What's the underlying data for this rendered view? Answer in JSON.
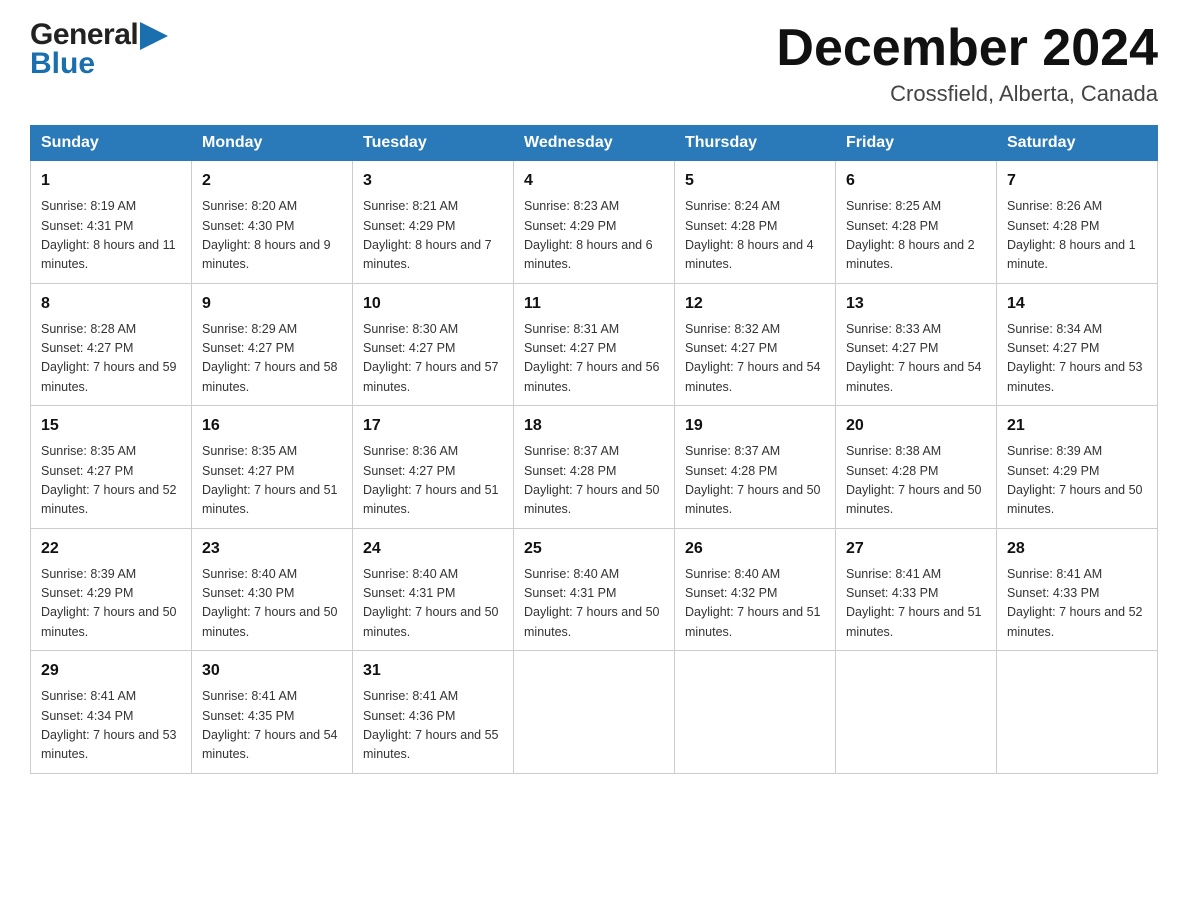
{
  "header": {
    "logo_general": "General",
    "logo_blue": "Blue",
    "month_title": "December 2024",
    "location": "Crossfield, Alberta, Canada"
  },
  "days_of_week": [
    "Sunday",
    "Monday",
    "Tuesday",
    "Wednesday",
    "Thursday",
    "Friday",
    "Saturday"
  ],
  "weeks": [
    [
      {
        "day": "1",
        "sunrise": "8:19 AM",
        "sunset": "4:31 PM",
        "daylight": "8 hours and 11 minutes."
      },
      {
        "day": "2",
        "sunrise": "8:20 AM",
        "sunset": "4:30 PM",
        "daylight": "8 hours and 9 minutes."
      },
      {
        "day": "3",
        "sunrise": "8:21 AM",
        "sunset": "4:29 PM",
        "daylight": "8 hours and 7 minutes."
      },
      {
        "day": "4",
        "sunrise": "8:23 AM",
        "sunset": "4:29 PM",
        "daylight": "8 hours and 6 minutes."
      },
      {
        "day": "5",
        "sunrise": "8:24 AM",
        "sunset": "4:28 PM",
        "daylight": "8 hours and 4 minutes."
      },
      {
        "day": "6",
        "sunrise": "8:25 AM",
        "sunset": "4:28 PM",
        "daylight": "8 hours and 2 minutes."
      },
      {
        "day": "7",
        "sunrise": "8:26 AM",
        "sunset": "4:28 PM",
        "daylight": "8 hours and 1 minute."
      }
    ],
    [
      {
        "day": "8",
        "sunrise": "8:28 AM",
        "sunset": "4:27 PM",
        "daylight": "7 hours and 59 minutes."
      },
      {
        "day": "9",
        "sunrise": "8:29 AM",
        "sunset": "4:27 PM",
        "daylight": "7 hours and 58 minutes."
      },
      {
        "day": "10",
        "sunrise": "8:30 AM",
        "sunset": "4:27 PM",
        "daylight": "7 hours and 57 minutes."
      },
      {
        "day": "11",
        "sunrise": "8:31 AM",
        "sunset": "4:27 PM",
        "daylight": "7 hours and 56 minutes."
      },
      {
        "day": "12",
        "sunrise": "8:32 AM",
        "sunset": "4:27 PM",
        "daylight": "7 hours and 54 minutes."
      },
      {
        "day": "13",
        "sunrise": "8:33 AM",
        "sunset": "4:27 PM",
        "daylight": "7 hours and 54 minutes."
      },
      {
        "day": "14",
        "sunrise": "8:34 AM",
        "sunset": "4:27 PM",
        "daylight": "7 hours and 53 minutes."
      }
    ],
    [
      {
        "day": "15",
        "sunrise": "8:35 AM",
        "sunset": "4:27 PM",
        "daylight": "7 hours and 52 minutes."
      },
      {
        "day": "16",
        "sunrise": "8:35 AM",
        "sunset": "4:27 PM",
        "daylight": "7 hours and 51 minutes."
      },
      {
        "day": "17",
        "sunrise": "8:36 AM",
        "sunset": "4:27 PM",
        "daylight": "7 hours and 51 minutes."
      },
      {
        "day": "18",
        "sunrise": "8:37 AM",
        "sunset": "4:28 PM",
        "daylight": "7 hours and 50 minutes."
      },
      {
        "day": "19",
        "sunrise": "8:37 AM",
        "sunset": "4:28 PM",
        "daylight": "7 hours and 50 minutes."
      },
      {
        "day": "20",
        "sunrise": "8:38 AM",
        "sunset": "4:28 PM",
        "daylight": "7 hours and 50 minutes."
      },
      {
        "day": "21",
        "sunrise": "8:39 AM",
        "sunset": "4:29 PM",
        "daylight": "7 hours and 50 minutes."
      }
    ],
    [
      {
        "day": "22",
        "sunrise": "8:39 AM",
        "sunset": "4:29 PM",
        "daylight": "7 hours and 50 minutes."
      },
      {
        "day": "23",
        "sunrise": "8:40 AM",
        "sunset": "4:30 PM",
        "daylight": "7 hours and 50 minutes."
      },
      {
        "day": "24",
        "sunrise": "8:40 AM",
        "sunset": "4:31 PM",
        "daylight": "7 hours and 50 minutes."
      },
      {
        "day": "25",
        "sunrise": "8:40 AM",
        "sunset": "4:31 PM",
        "daylight": "7 hours and 50 minutes."
      },
      {
        "day": "26",
        "sunrise": "8:40 AM",
        "sunset": "4:32 PM",
        "daylight": "7 hours and 51 minutes."
      },
      {
        "day": "27",
        "sunrise": "8:41 AM",
        "sunset": "4:33 PM",
        "daylight": "7 hours and 51 minutes."
      },
      {
        "day": "28",
        "sunrise": "8:41 AM",
        "sunset": "4:33 PM",
        "daylight": "7 hours and 52 minutes."
      }
    ],
    [
      {
        "day": "29",
        "sunrise": "8:41 AM",
        "sunset": "4:34 PM",
        "daylight": "7 hours and 53 minutes."
      },
      {
        "day": "30",
        "sunrise": "8:41 AM",
        "sunset": "4:35 PM",
        "daylight": "7 hours and 54 minutes."
      },
      {
        "day": "31",
        "sunrise": "8:41 AM",
        "sunset": "4:36 PM",
        "daylight": "7 hours and 55 minutes."
      },
      null,
      null,
      null,
      null
    ]
  ]
}
